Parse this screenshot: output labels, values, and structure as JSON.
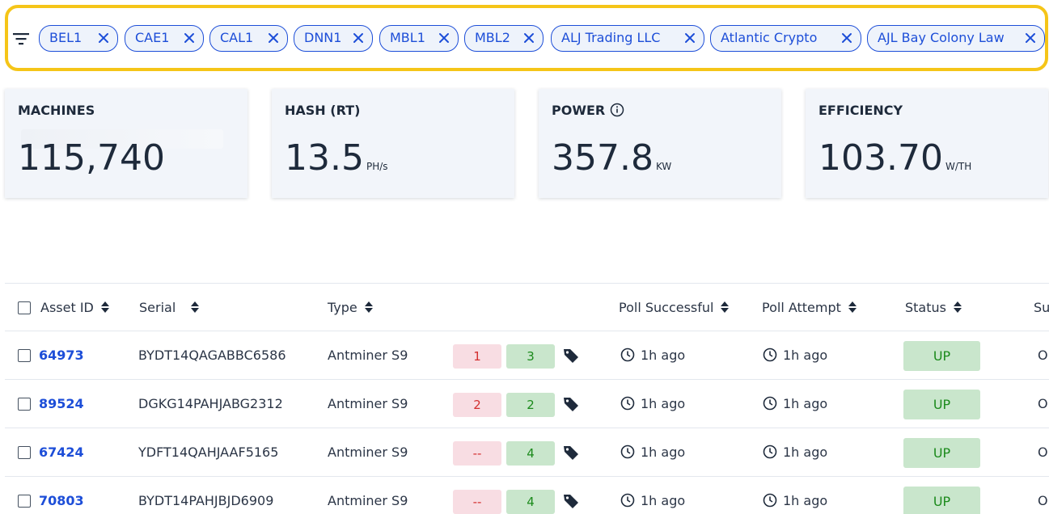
{
  "filters": {
    "chips": [
      "BEL1",
      "CAE1",
      "CAL1",
      "DNN1",
      "MBL1",
      "MBL2",
      "ALJ Trading LLC",
      "Atlantic Crypto",
      "AJL Bay Colony Law"
    ]
  },
  "stats": [
    {
      "title": "MACHINES",
      "value": "115,740",
      "unit": ""
    },
    {
      "title": "HASH (RT)",
      "value": "13.5",
      "unit": "PH/s"
    },
    {
      "title": "POWER",
      "value": "357.8",
      "unit": "KW"
    },
    {
      "title": "EFFICIENCY",
      "value": "103.70",
      "unit": "W/TH"
    }
  ],
  "table": {
    "columns": {
      "asset_id": "Asset ID",
      "serial": "Serial",
      "type": "Type",
      "poll_successful": "Poll Successful",
      "poll_attempt": "Poll Attempt",
      "status": "Status",
      "su": "Su"
    },
    "rows": [
      {
        "asset_id": "64973",
        "serial": "BYDT14QAGABBC6586",
        "type": "Antminer S9",
        "red": "1",
        "green": "3",
        "poll_successful": "1h ago",
        "poll_attempt": "1h ago",
        "status": "UP",
        "su": "OK"
      },
      {
        "asset_id": "89524",
        "serial": "DGKG14PAHJABG2312",
        "type": "Antminer S9",
        "red": "2",
        "green": "2",
        "poll_successful": "1h ago",
        "poll_attempt": "1h ago",
        "status": "UP",
        "su": "OK"
      },
      {
        "asset_id": "67424",
        "serial": "YDFT14QAHJAAF5165",
        "type": "Antminer S9",
        "red": "--",
        "green": "4",
        "poll_successful": "1h ago",
        "poll_attempt": "1h ago",
        "status": "UP",
        "su": "OK"
      },
      {
        "asset_id": "70803",
        "serial": "BYDT14PAHJBJD6909",
        "type": "Antminer S9",
        "red": "--",
        "green": "4",
        "poll_successful": "1h ago",
        "poll_attempt": "1h ago",
        "status": "UP",
        "su": "OK"
      }
    ]
  },
  "colors": {
    "accent": "#1d4ed8",
    "highlight": "#f5c518",
    "up": "#c9e6cc",
    "error": "#f8dde3"
  }
}
